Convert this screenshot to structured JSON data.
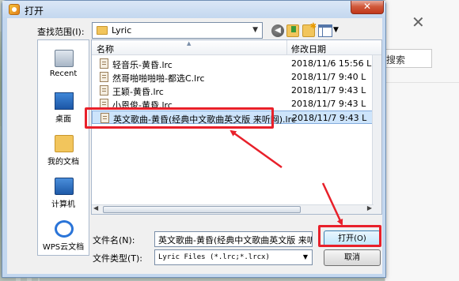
{
  "dialog": {
    "title": "打开",
    "close_label": "✕"
  },
  "lookin": {
    "label": "查找范围(I):",
    "value": "Lyric"
  },
  "places": [
    {
      "label": "Recent",
      "icon": "recent-icon"
    },
    {
      "label": "桌面",
      "icon": "desktop-icon"
    },
    {
      "label": "我的文档",
      "icon": "documents-folder-icon"
    },
    {
      "label": "计算机",
      "icon": "computer-icon"
    },
    {
      "label": "WPS云文档",
      "icon": "cloud-icon"
    }
  ],
  "filelist": {
    "columns": {
      "name": "名称",
      "date": "修改日期"
    },
    "files": [
      {
        "name": "轻音乐-黄昏.lrc",
        "date": "2018/11/6 15:56",
        "suffix": "L"
      },
      {
        "name": "然哥啪啪啪啪-都选C.lrc",
        "date": "2018/11/7 9:40",
        "suffix": "L"
      },
      {
        "name": "王颖-黄昏.lrc",
        "date": "2018/11/7 9:43",
        "suffix": "L"
      },
      {
        "name": "小恩俊-黄昏.lrc",
        "date": "2018/11/7 9:43",
        "suffix": "L"
      },
      {
        "name": "英文歌曲-黄昏(经典中文歌曲英文版 来听网).lrc",
        "date": "2018/11/7 9:43",
        "suffix": "L",
        "selected": true
      }
    ]
  },
  "filename": {
    "label": "文件名(N):",
    "value": "英文歌曲-黄昏(经典中文歌曲英文版 来听"
  },
  "filetype": {
    "label": "文件类型(T):",
    "value": "Lyric Files (*.lrc;*.lrcx)"
  },
  "buttons": {
    "open": "打开(O)",
    "cancel": "取消"
  },
  "side_panel": {
    "close_label": "✕",
    "search_text": "搜索"
  },
  "colors": {
    "highlight": "#e8202a",
    "selection": "#cde4fb"
  }
}
